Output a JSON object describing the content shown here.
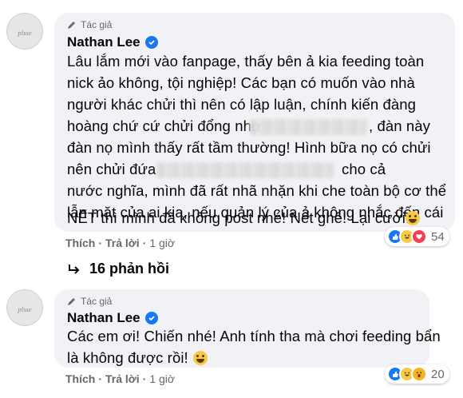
{
  "comments": [
    {
      "author_tag": "Tác giả",
      "name": "Nathan Lee",
      "lines": [
        "Lâu lắm mới vào fanpage, thấy bên ả kia feeding toàn",
        "nick ảo không, tội nghiệp! Các bạn có muốn vào nhà",
        "người khác chửi thì nên có lập luận, chính kiến đàng",
        "hoàng chứ cứ chửi đổng như",
        ", đàn này",
        "đàn nọ mình thấy rất tầm thường! Hình bữa nọ có chửi",
        "nên chửi đứa",
        "cho cả",
        "nước nghĩa, mình đã rất nhã nhặn khi che toàn bộ cơ thể",
        "lẫn mặt của ai kia, nếu quản lý của ả không nhắc đến cái",
        "NẾT thì mình đã không post nhé! Nết ghê! Lại cười!"
      ],
      "actions": {
        "like": "Thích",
        "reply": "Trả lời",
        "time": "1 giờ"
      },
      "reaction_count": "54",
      "replies_label": "16 phản hồi"
    },
    {
      "author_tag": "Tác giả",
      "name": "Nathan Lee",
      "lines": [
        "Các em ơi! Chiến nhé! Anh tính tha mà chơi feeding bẩn",
        "là không được rồi!"
      ],
      "actions": {
        "like": "Thích",
        "reply": "Trả lời",
        "time": "1 giờ"
      },
      "reaction_count": "20"
    }
  ],
  "colors": {
    "bubble": "#f0f2f5",
    "meta_text": "#65676b",
    "verified": "#1877f2"
  },
  "icons": [
    "pencil-icon",
    "verified-badge-icon",
    "reply-arrow-icon",
    "like-reaction-icon",
    "haha-reaction-icon",
    "love-reaction-icon",
    "wow-reaction-icon"
  ]
}
